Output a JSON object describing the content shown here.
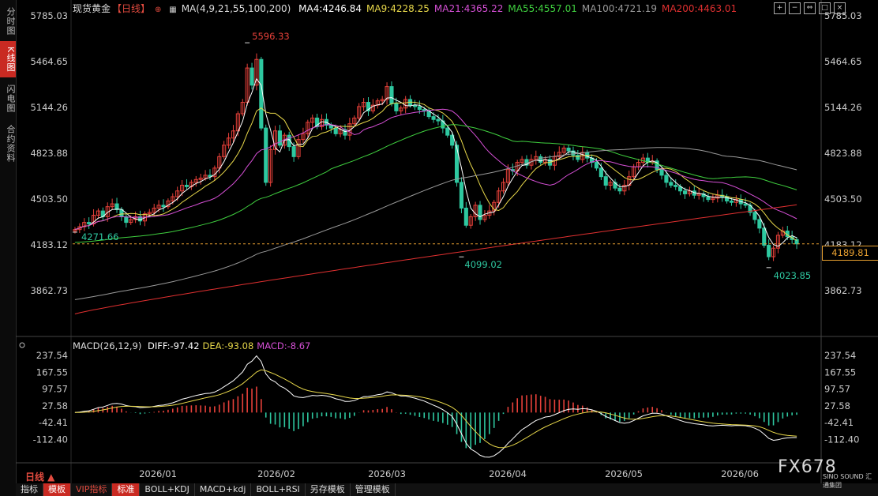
{
  "sidebar": {
    "tabs": [
      "分时图",
      "K线图",
      "闪电图",
      "合约资料"
    ],
    "active": 1
  },
  "legend": {
    "symbol": "现货黄金",
    "period": "【日线】",
    "ma_params": "MA(4,9,21,55,100,200)",
    "items": [
      {
        "label": "MA4:4246.84",
        "color": "#ffffff"
      },
      {
        "label": "MA9:4228.25",
        "color": "#e8d84a"
      },
      {
        "label": "MA21:4365.22",
        "color": "#d54fd5"
      },
      {
        "label": "MA55:4557.01",
        "color": "#3fcf3f"
      },
      {
        "label": "MA100:4721.19",
        "color": "#9a9a9a"
      },
      {
        "label": "MA200:4463.01",
        "color": "#e03030"
      }
    ]
  },
  "macd_legend": {
    "title": "MACD(26,12,9)",
    "items": [
      {
        "label": "DIFF:-97.42",
        "color": "#ffffff"
      },
      {
        "label": "DEA:-93.08",
        "color": "#e8d84a"
      },
      {
        "label": "MACD:-8.67",
        "color": "#d54fd5"
      }
    ]
  },
  "top_icons": [
    "+",
    "−",
    "⇔",
    "□",
    "×"
  ],
  "current_price": "4189.81",
  "bottom": {
    "period_label": "日线 ▲",
    "toolbar": [
      "指标",
      "模板",
      "VIP指标",
      "标准",
      "BOLL+KDJ",
      "MACD+kdj",
      "BOLL+RSI",
      "另存模板",
      "管理模板"
    ]
  },
  "watermark": {
    "brand": "FX678",
    "sub": "SINO SOUND 汇通集团"
  },
  "chart_data": {
    "type": "candlestick",
    "price_axis": {
      "ticks": [
        5785.03,
        5464.65,
        5144.26,
        4823.88,
        4503.5,
        4183.12,
        3862.73
      ],
      "ylim": [
        3862.73,
        5785.03
      ]
    },
    "x_ticks": [
      "2026/01",
      "2026/02",
      "2026/03",
      "2026/04",
      "2026/05",
      "2026/06"
    ],
    "annotations": [
      {
        "label": "5596.33",
        "value": 5596.33
      },
      {
        "label": "4271.66",
        "value": 4271.66
      },
      {
        "label": "4099.02",
        "value": 4099.02
      },
      {
        "label": "4023.85",
        "value": 4023.85
      }
    ],
    "closes": [
      4290,
      4310,
      4340,
      4330,
      4390,
      4420,
      4380,
      4450,
      4470,
      4430,
      4380,
      4340,
      4360,
      4380,
      4350,
      4400,
      4410,
      4440,
      4460,
      4450,
      4490,
      4520,
      4560,
      4600,
      4590,
      4620,
      4640,
      4650,
      4670,
      4660,
      4720,
      4800,
      4880,
      4930,
      4980,
      5100,
      5180,
      5420,
      5300,
      5480,
      5000,
      4620,
      4850,
      4980,
      4880,
      4950,
      4870,
      4800,
      4920,
      4960,
      5040,
      5070,
      5010,
      5060,
      5020,
      5000,
      4960,
      4990,
      4950,
      5030,
      5070,
      5150,
      5180,
      5120,
      5160,
      5190,
      5200,
      5290,
      5170,
      5120,
      5140,
      5200,
      5160,
      5150,
      5130,
      5120,
      5080,
      5060,
      5050,
      5000,
      4950,
      4880,
      4620,
      4440,
      4320,
      4380,
      4460,
      4360,
      4390,
      4420,
      4480,
      4560,
      4620,
      4710,
      4700,
      4760,
      4780,
      4740,
      4780,
      4800,
      4760,
      4780,
      4740,
      4800,
      4830,
      4860,
      4840,
      4810,
      4780,
      4830,
      4790,
      4760,
      4720,
      4660,
      4600,
      4620,
      4580,
      4560,
      4600,
      4660,
      4730,
      4760,
      4790,
      4760,
      4770,
      4710,
      4670,
      4620,
      4600,
      4590,
      4560,
      4540,
      4560,
      4530,
      4540,
      4520,
      4500,
      4510,
      4530,
      4520,
      4490,
      4480,
      4500,
      4470,
      4460,
      4410,
      4360,
      4300,
      4180,
      4100,
      4160,
      4250,
      4280,
      4240,
      4220,
      4190
    ],
    "opens": [
      4280,
      4290,
      4310,
      4340,
      4330,
      4390,
      4420,
      4380,
      4450,
      4470,
      4430,
      4380,
      4340,
      4360,
      4380,
      4350,
      4400,
      4410,
      4440,
      4460,
      4450,
      4490,
      4520,
      4560,
      4600,
      4590,
      4620,
      4640,
      4650,
      4670,
      4660,
      4720,
      4800,
      4880,
      4930,
      4980,
      5100,
      5180,
      5420,
      5300,
      5480,
      5000,
      4620,
      4850,
      4980,
      4880,
      4950,
      4870,
      4800,
      4920,
      4960,
      5040,
      5070,
      5010,
      5060,
      5020,
      5000,
      4960,
      4990,
      4950,
      5030,
      5070,
      5150,
      5180,
      5120,
      5160,
      5190,
      5200,
      5290,
      5170,
      5120,
      5140,
      5200,
      5160,
      5150,
      5130,
      5120,
      5080,
      5060,
      5050,
      5000,
      4950,
      4880,
      4620,
      4440,
      4320,
      4380,
      4460,
      4360,
      4390,
      4420,
      4480,
      4560,
      4620,
      4710,
      4700,
      4760,
      4780,
      4740,
      4780,
      4800,
      4760,
      4780,
      4740,
      4800,
      4830,
      4860,
      4840,
      4810,
      4780,
      4830,
      4790,
      4760,
      4720,
      4660,
      4600,
      4620,
      4580,
      4560,
      4600,
      4660,
      4730,
      4760,
      4790,
      4760,
      4770,
      4710,
      4670,
      4620,
      4600,
      4590,
      4560,
      4540,
      4560,
      4530,
      4540,
      4520,
      4500,
      4510,
      4530,
      4520,
      4490,
      4480,
      4500,
      4470,
      4460,
      4410,
      4360,
      4300,
      4180,
      4100,
      4160,
      4250,
      4280,
      4240,
      4220
    ],
    "macd_axis": {
      "ticks": [
        237.54,
        167.55,
        97.57,
        27.58,
        -42.41,
        -112.4
      ],
      "ylim": [
        -150,
        237.54
      ]
    }
  }
}
